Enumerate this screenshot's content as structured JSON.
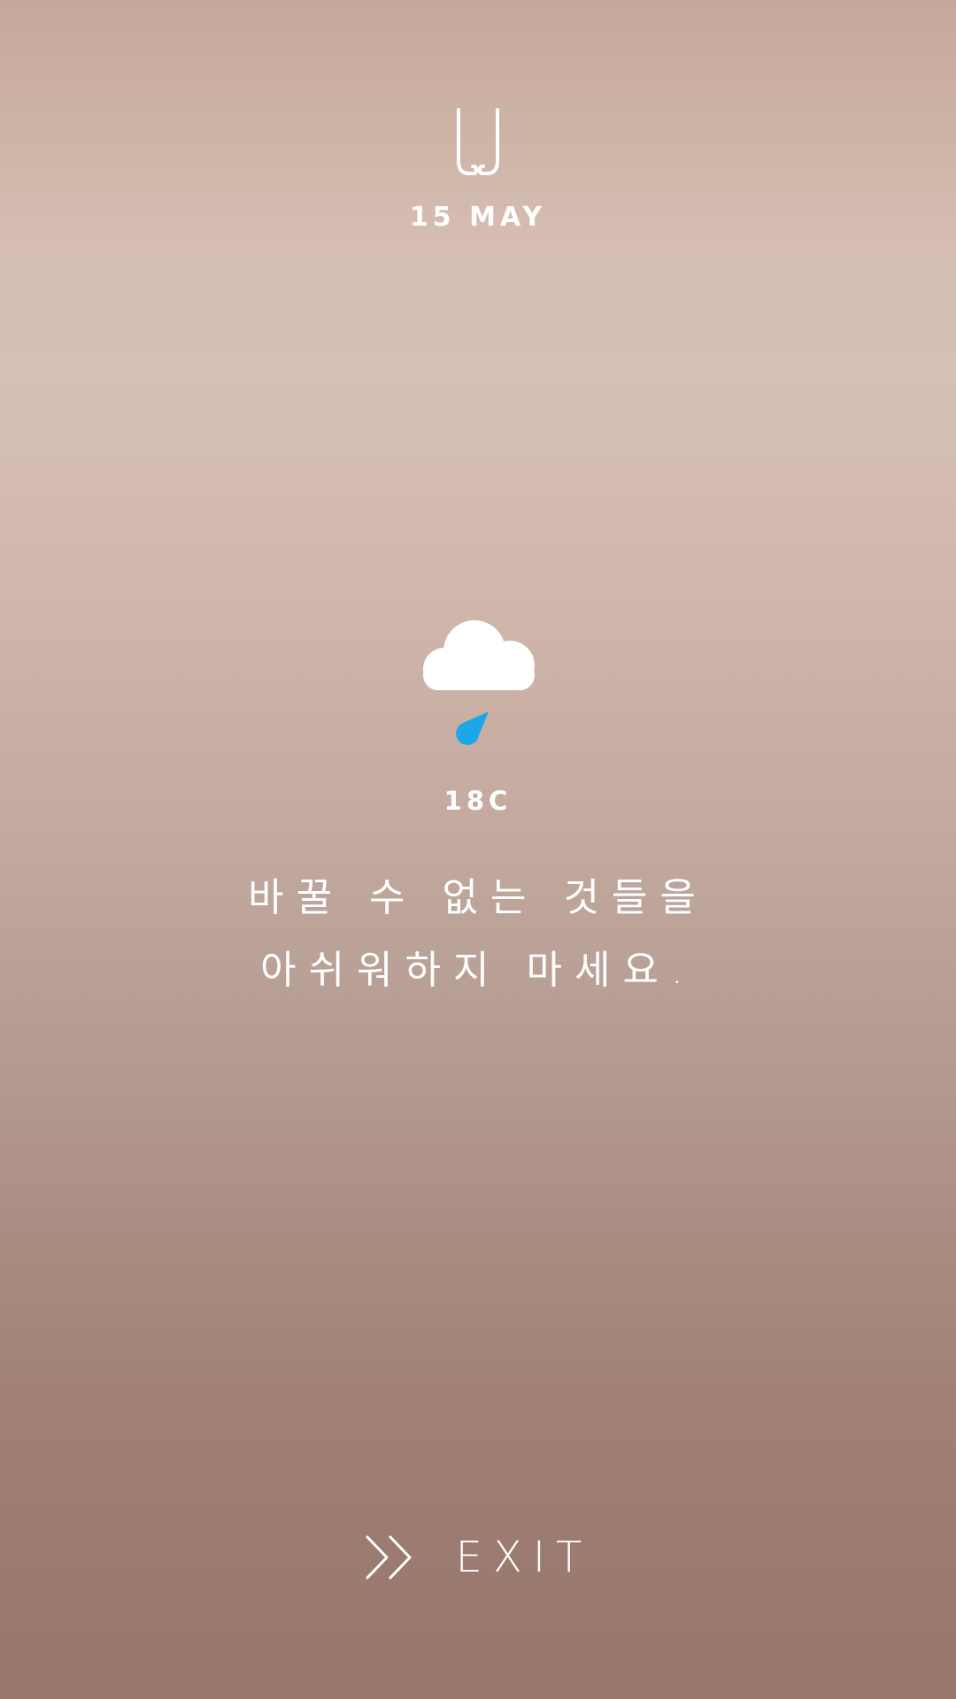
{
  "header": {
    "logo_icon": "u-logo-icon",
    "date": "15 MAY"
  },
  "weather": {
    "icon": "cloud-rain-icon",
    "drop_color": "#1ea7e8",
    "temperature": "18C"
  },
  "quote": {
    "line1": "바꿀 수 없는 것들을",
    "line2": "아쉬워하지 마세요."
  },
  "exit": {
    "icon": "double-chevron-right-icon",
    "label": "EXIT"
  }
}
